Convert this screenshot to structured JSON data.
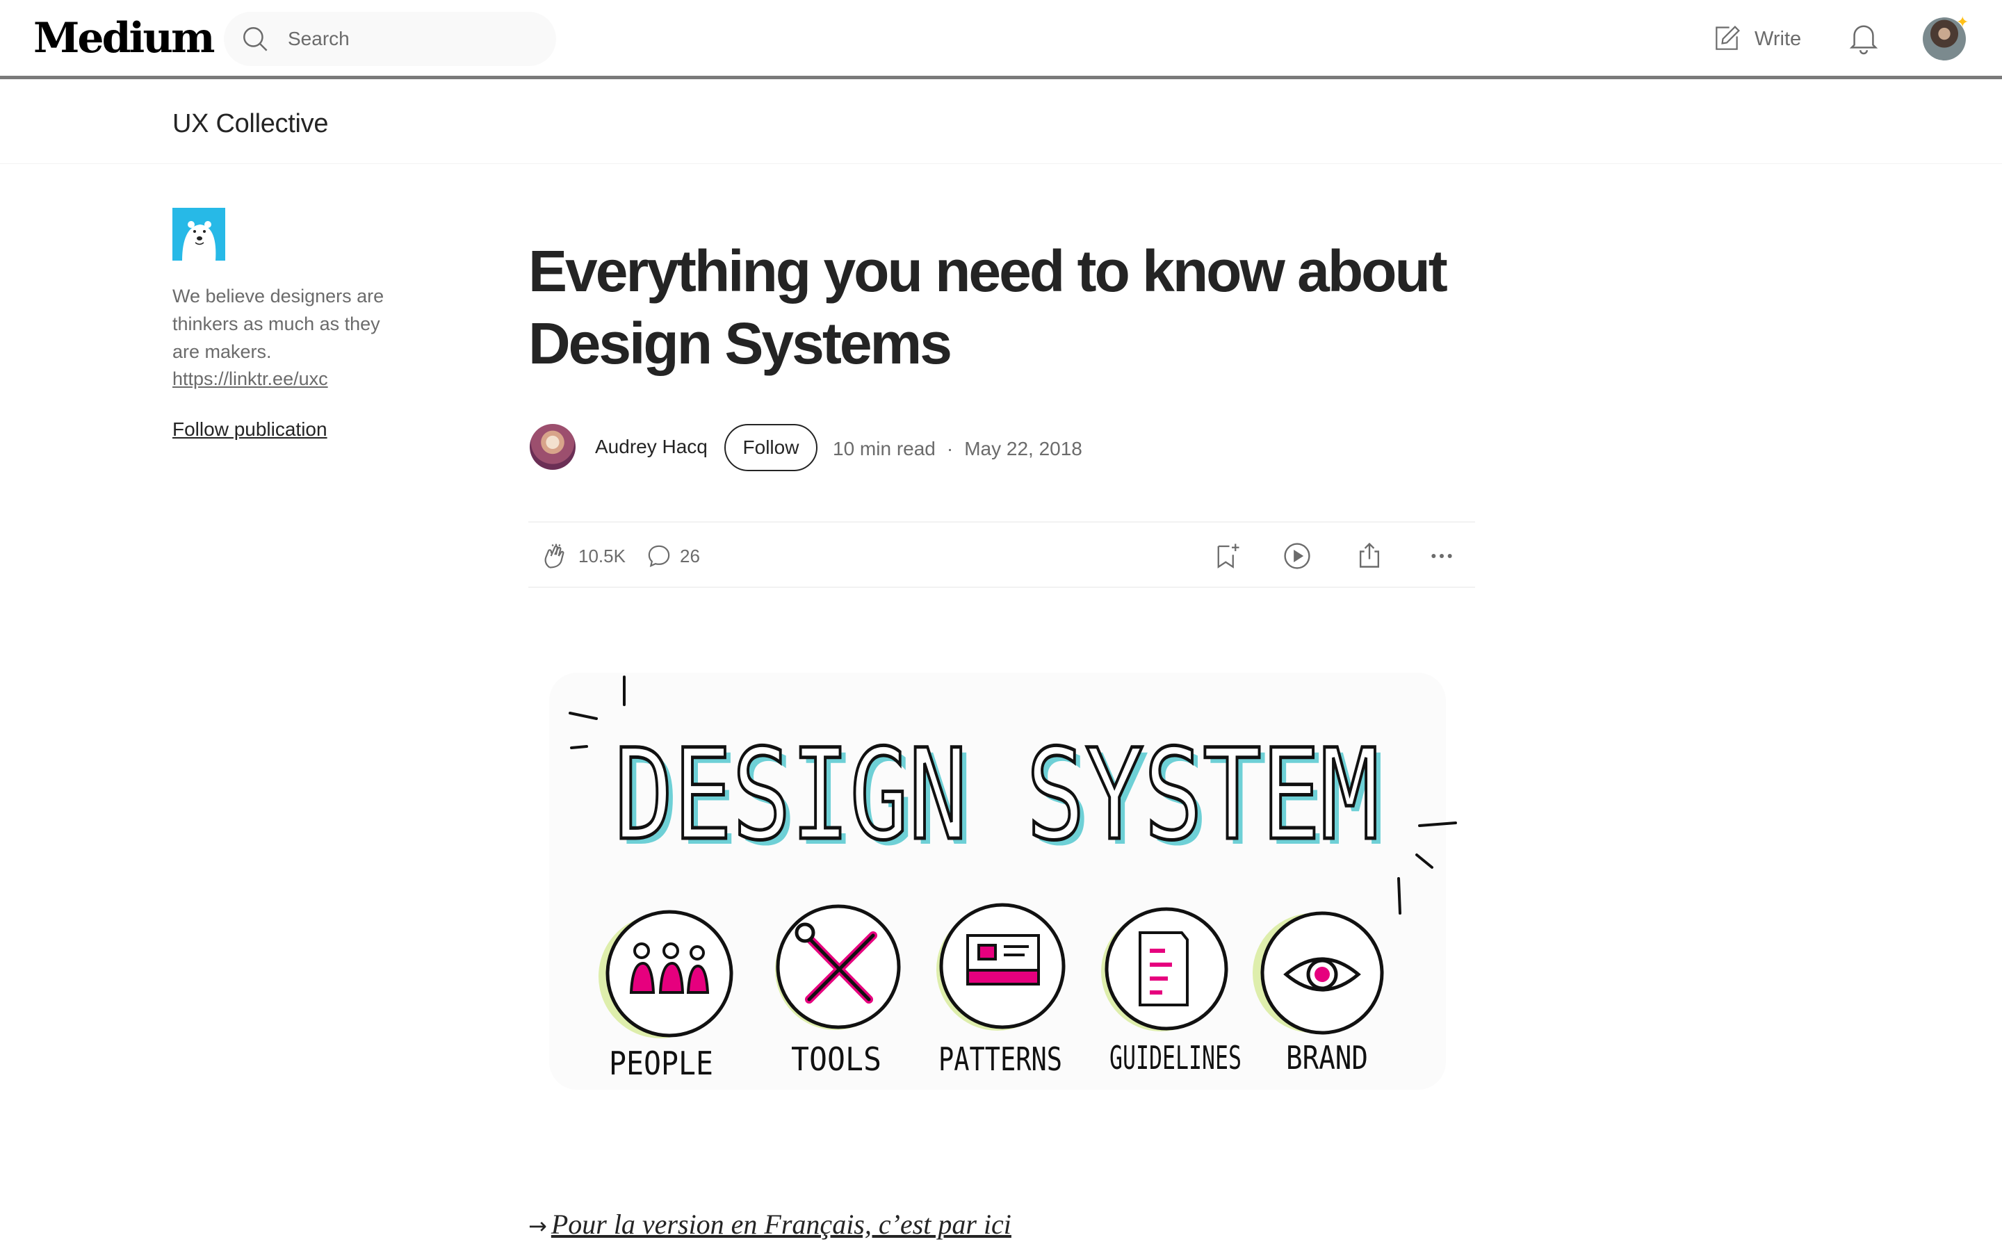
{
  "topbar": {
    "logo": "Medium",
    "search_placeholder": "Search",
    "write_label": "Write"
  },
  "publication": {
    "name": "UX Collective",
    "description": "We believe designers are thinkers as much as they are makers.",
    "link": "https://linktr.ee/uxc",
    "follow_label": "Follow publication"
  },
  "article": {
    "title": "Everything you need to know about Design Systems",
    "author": "Audrey Hacq",
    "follow_label": "Follow",
    "read_time": "10 min read",
    "separator": "·",
    "date": "May 22, 2018",
    "claps": "10.5K",
    "responses": "26",
    "french_link": "Pour la version en Français, c’est par ici"
  },
  "hero": {
    "heading": "DESIGN SYSTEM",
    "items": [
      {
        "label": "PEOPLE"
      },
      {
        "label": "TOOLS"
      },
      {
        "label": "PATTERNS"
      },
      {
        "label": "GUIDELINES"
      },
      {
        "label": "BRAND"
      }
    ]
  },
  "colors": {
    "text": "#242424",
    "muted": "#6b6b6b",
    "accent_cyan": "#3fc1c9",
    "accent_magenta": "#e6007e",
    "accent_lime": "#c6e36b"
  }
}
